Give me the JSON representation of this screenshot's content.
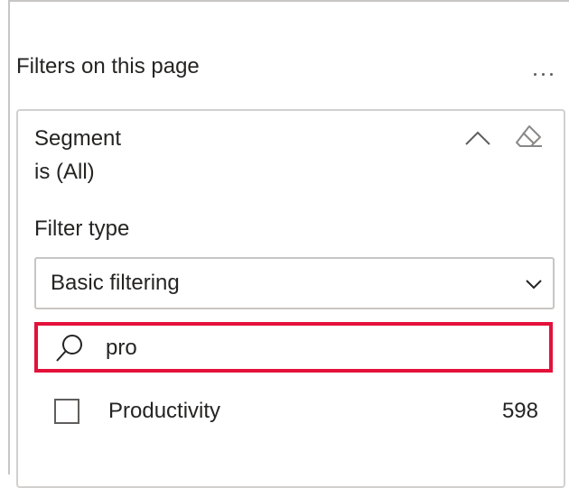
{
  "pane": {
    "section_title": "Filters on this page",
    "more_options_icon": "more-horizontal-icon"
  },
  "filter_card": {
    "field_name": "Segment",
    "field_state": "is (All)",
    "collapse_icon": "chevron-up-icon",
    "clear_icon": "eraser-icon",
    "filter_type_label": "Filter type",
    "filter_type_value": "Basic filtering",
    "filter_type_chevron_icon": "chevron-down-icon",
    "search": {
      "icon": "search-icon",
      "value": "pro",
      "highlight_color": "#e3123b"
    },
    "values": [
      {
        "label": "Productivity",
        "count": "598",
        "checked": false
      }
    ]
  }
}
